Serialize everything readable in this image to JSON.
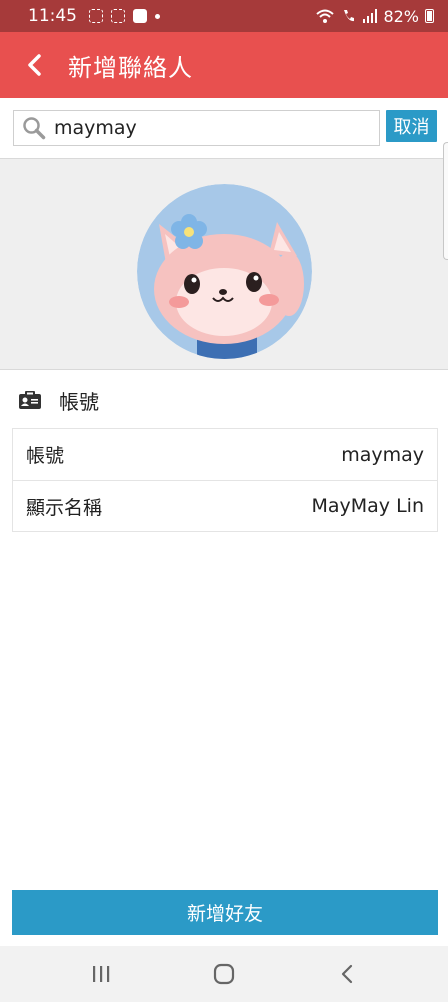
{
  "status_bar": {
    "time": "11:45",
    "battery": "82%"
  },
  "header": {
    "title": "新增聯絡人"
  },
  "search": {
    "value": "maymay",
    "cancel_label": "取消"
  },
  "section": {
    "title": "帳號"
  },
  "info_rows": [
    {
      "label": "帳號",
      "value": "maymay"
    },
    {
      "label": "顯示名稱",
      "value": "MayMay Lin"
    }
  ],
  "actions": {
    "add_friend_label": "新增好友"
  },
  "colors": {
    "status_bar": "#a63a3a",
    "header": "#e8504f",
    "accent": "#2b9ac7",
    "banner": "#efefef"
  },
  "icons": {
    "back": "chevron-left-icon",
    "search": "search-icon",
    "card": "contact-card-icon",
    "nav_recents": "recents-icon",
    "nav_home": "home-icon",
    "nav_back": "back-nav-icon"
  }
}
